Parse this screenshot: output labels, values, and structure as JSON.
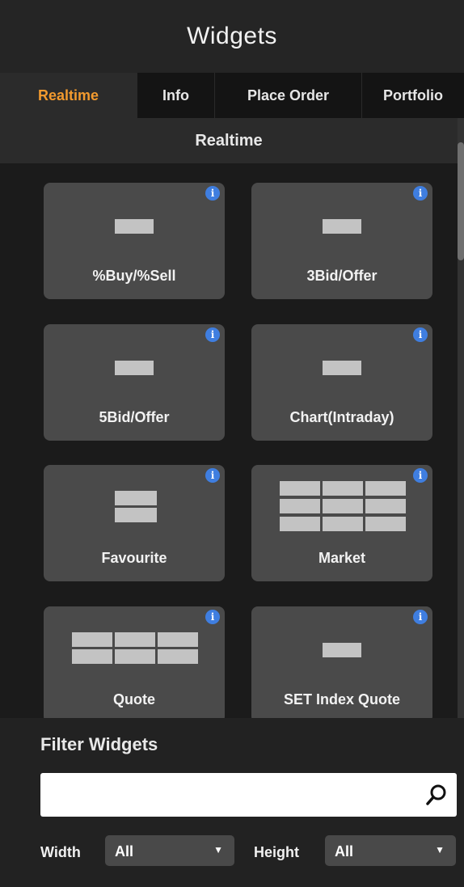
{
  "header": {
    "title": "Widgets"
  },
  "tabs": [
    {
      "label": "Realtime",
      "active": true
    },
    {
      "label": "Info",
      "active": false
    },
    {
      "label": "Place Order",
      "active": false
    },
    {
      "label": "Portfolio",
      "active": false
    }
  ],
  "section": {
    "title": "Realtime"
  },
  "widgets": [
    {
      "label": "%Buy/%Sell",
      "thumbnail": "single-block"
    },
    {
      "label": "3Bid/Offer",
      "thumbnail": "single-block"
    },
    {
      "label": "5Bid/Offer",
      "thumbnail": "single-block"
    },
    {
      "label": "Chart(Intraday)",
      "thumbnail": "single-block"
    },
    {
      "label": "Favourite",
      "thumbnail": "two-rows"
    },
    {
      "label": "Market",
      "thumbnail": "3x3-grid"
    },
    {
      "label": "Quote",
      "thumbnail": "3x2-grid"
    },
    {
      "label": "SET Index Quote",
      "thumbnail": "single-block"
    }
  ],
  "info_icon_glyph": "i",
  "filter": {
    "title": "Filter Widgets",
    "search_value": "",
    "width_label": "Width",
    "width_value": "All",
    "height_label": "Height",
    "height_value": "All",
    "dropdown_arrow": "▼"
  },
  "colors": {
    "accent": "#f29a2e",
    "info_icon": "#3f7ee0",
    "card_bg": "#4a4a4a",
    "background": "#1b1b1b"
  }
}
